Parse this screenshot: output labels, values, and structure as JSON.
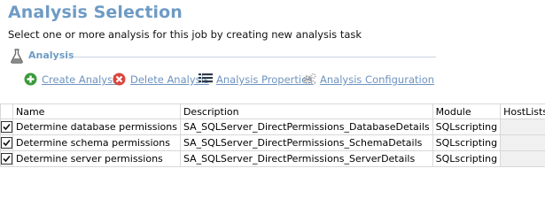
{
  "header": {
    "title": "Analysis Selection",
    "subtitle": "Select one or more analysis for this job by creating new analysis task"
  },
  "section": {
    "title": "Analysis",
    "icon": "flask-icon"
  },
  "toolbar": {
    "create_label": "Create Analysis",
    "delete_label": "Delete Analysis",
    "properties_label": "Analysis Properties",
    "configuration_label": "Analysis Configuration"
  },
  "colors": {
    "accent": "#6e9bc5",
    "create_icon": "#3a9a3a",
    "delete_icon": "#d9463d",
    "gear_icon": "#9a9a9a"
  },
  "table": {
    "columns": [
      "Name",
      "Description",
      "Module",
      "HostLists"
    ],
    "rows": [
      {
        "checked": true,
        "name": "Determine database permissions",
        "description": "SA_SQLServer_DirectPermissions_DatabaseDetails",
        "module": "SQLscripting",
        "hostlists": ""
      },
      {
        "checked": true,
        "name": "Determine schema permissions",
        "description": "SA_SQLServer_DirectPermissions_SchemaDetails",
        "module": "SQLscripting",
        "hostlists": ""
      },
      {
        "checked": true,
        "name": "Determine server permissions",
        "description": "SA_SQLServer_DirectPermissions_ServerDetails",
        "module": "SQLscripting",
        "hostlists": ""
      }
    ]
  }
}
